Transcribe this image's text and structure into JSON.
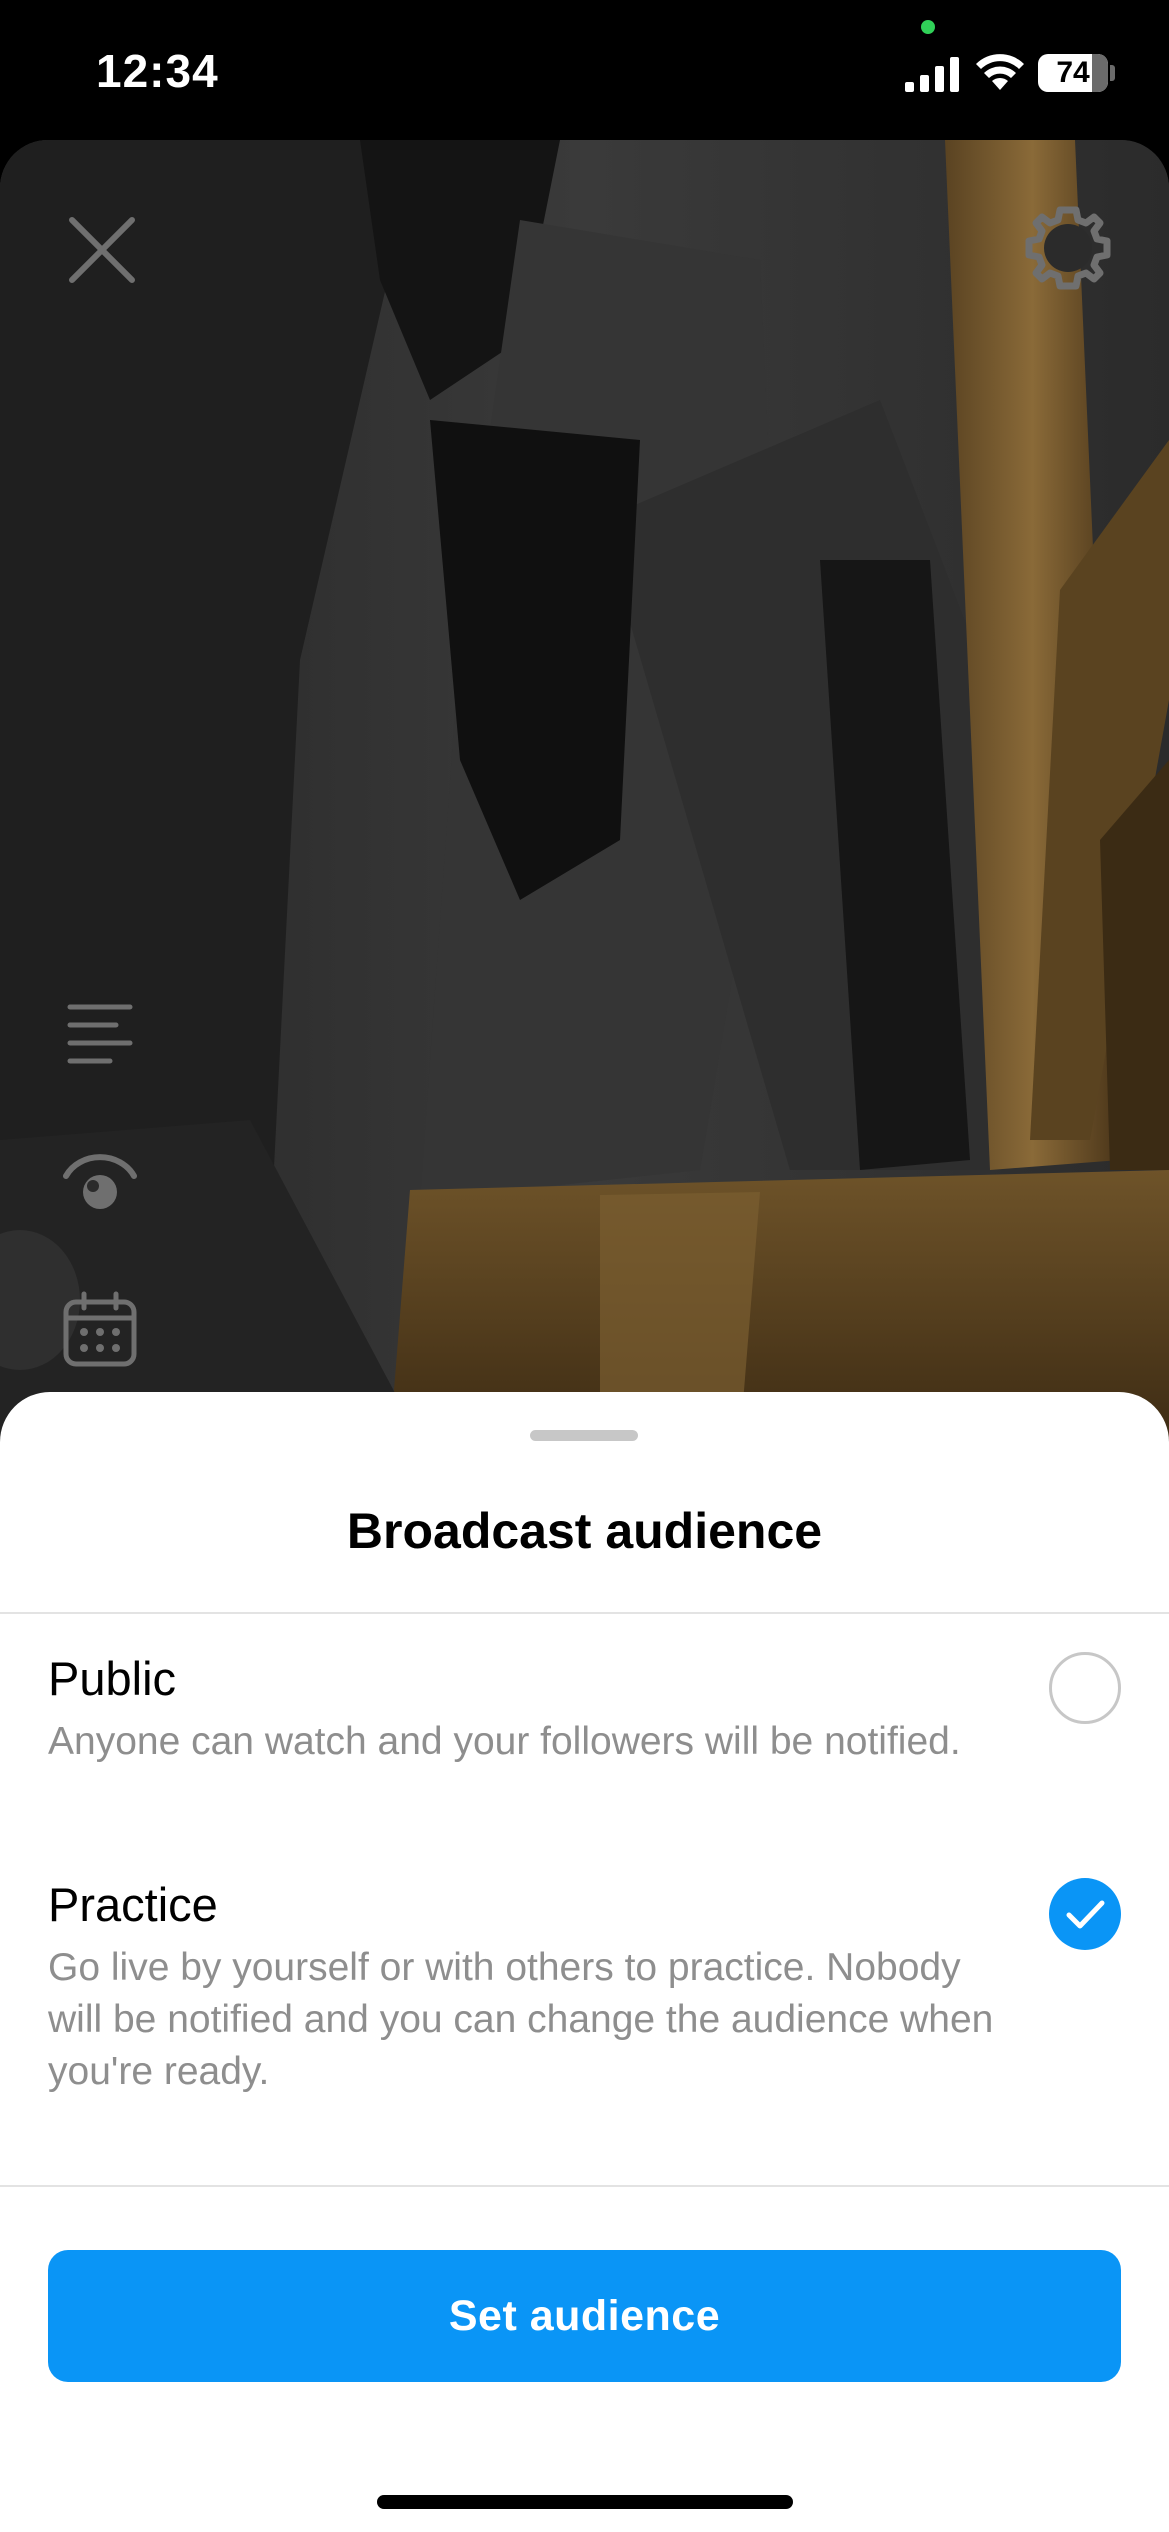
{
  "status_bar": {
    "time": "12:34",
    "battery": "74",
    "privacy_dot_color": "#30d158"
  },
  "camera": {
    "close_icon": "close-icon",
    "settings_icon": "gear-icon",
    "side_tools": [
      "text-align-icon",
      "eye-icon",
      "calendar-icon"
    ]
  },
  "sheet": {
    "title": "Broadcast audience",
    "options": [
      {
        "title": "Public",
        "description": "Anyone can watch and your followers will be notified.",
        "selected": false
      },
      {
        "title": "Practice",
        "description": "Go live by yourself or with others to practice. Nobody will be notified and you can change the audience when you're ready.",
        "selected": true
      }
    ],
    "button_label": "Set audience"
  },
  "colors": {
    "accent": "#0a95f6",
    "secondary_text": "#8e8e8e"
  }
}
